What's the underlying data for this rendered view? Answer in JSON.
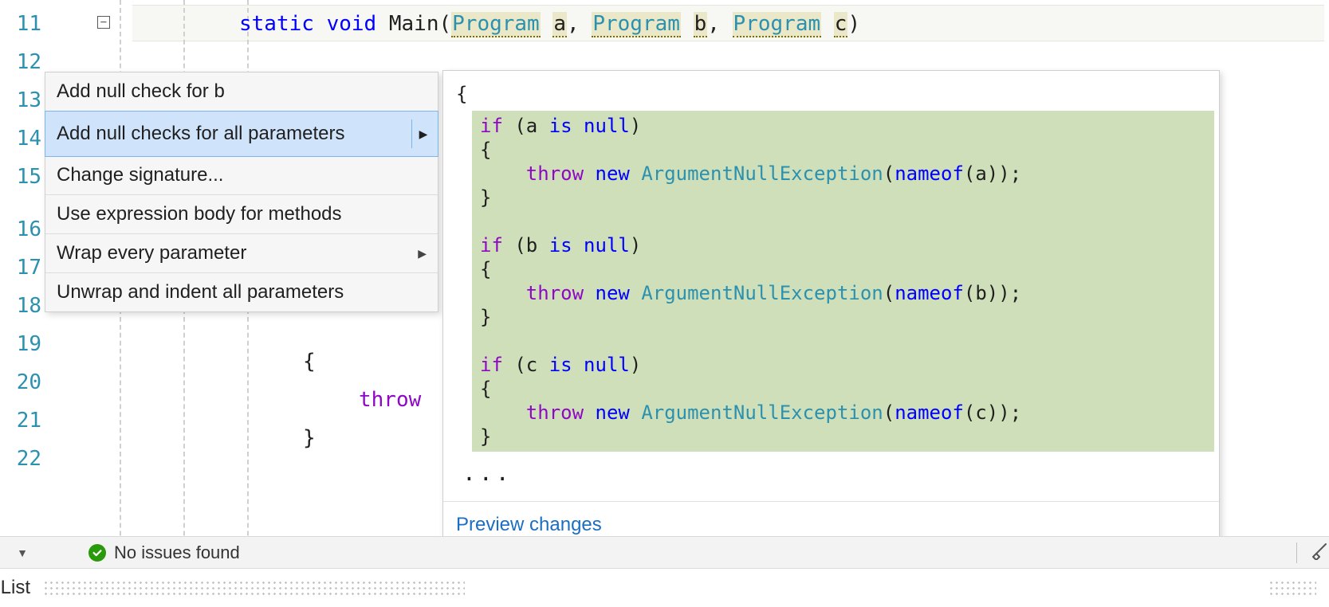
{
  "editor": {
    "line_numbers": [
      "11",
      "12",
      "13",
      "14",
      "15",
      "16",
      "17",
      "18",
      "19",
      "20",
      "21",
      "22"
    ],
    "main_line": {
      "kw_static": "static",
      "kw_void": "void",
      "method": "Main",
      "lp": "(",
      "type": "Program",
      "p_a": "a",
      "comma": ", ",
      "p_b": "b",
      "p_c": "c",
      "rp": ")"
    },
    "line19": "{",
    "line20": "throw",
    "line21": "}"
  },
  "menu": {
    "items": [
      {
        "label": "Add null check for b",
        "has_sub": false
      },
      {
        "label": "Add null checks for all parameters",
        "has_sub": true,
        "selected": true
      },
      {
        "label": "Change signature...",
        "has_sub": false,
        "sep_above": true
      },
      {
        "label": "Use expression body for methods",
        "has_sub": false
      },
      {
        "label": "Wrap every parameter",
        "has_sub": true
      },
      {
        "label": "Unwrap and indent all parameters",
        "has_sub": false
      }
    ]
  },
  "preview": {
    "open_brace": "{",
    "if_a": {
      "if": "if",
      "open": " (a ",
      "is": "is",
      "nul": " null",
      ")": ")"
    },
    "if_b": {
      "open": " (b "
    },
    "if_c": {
      "open": " (c "
    },
    "brace_open": "{",
    "throw": "throw",
    "new": "new",
    "exc": "ArgumentNullException",
    "nameof": "nameof",
    "arg_a": "(a));",
    "arg_b": "(b));",
    "arg_c": "(c));",
    "brace_close": "}",
    "ellipsis": "...",
    "footer_link": "Preview changes"
  },
  "status": {
    "label": "No issues found"
  },
  "bottom": {
    "label_left": "List"
  }
}
